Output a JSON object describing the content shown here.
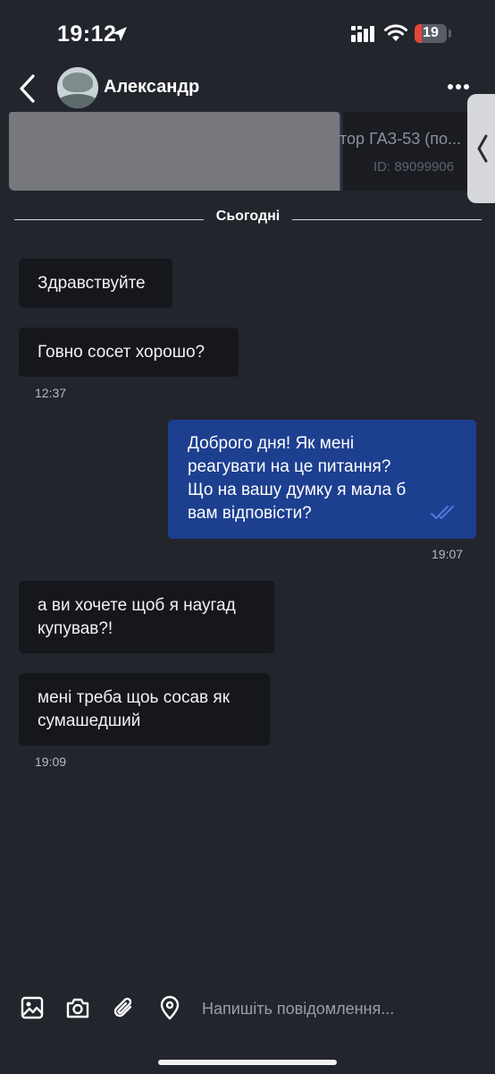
{
  "status_bar": {
    "time": "19:12",
    "battery": "19"
  },
  "header": {
    "contact_name": "Александр"
  },
  "listing": {
    "title": "тор ГАЗ-53 (по...",
    "id": "ID: 89099906"
  },
  "date_separator": "Сьогодні",
  "messages": [
    {
      "direction": "in",
      "text": "Здравствуйте"
    },
    {
      "direction": "in",
      "text": "Говно сосет хорошо?",
      "time": "12:37"
    },
    {
      "direction": "out",
      "lines": [
        "Доброго дня! Як мені",
        "реагувати на це питання?",
        "Що на вашу думку я мала б",
        "вам відповісти?"
      ],
      "time": "19:07",
      "status": "read"
    },
    {
      "direction": "in",
      "lines": [
        "а ви хочете щоб я наугад",
        "купував?!"
      ]
    },
    {
      "direction": "in",
      "lines": [
        "мені треба щоь сосав як",
        "сумашедший"
      ],
      "time": "19:09"
    }
  ],
  "composer": {
    "placeholder": "Напишіть повідомлення..."
  },
  "icons": {
    "back": "chevron-left-icon",
    "more": "more-dots-icon",
    "side_tab": "chevron-left-icon",
    "gallery": "image-icon",
    "camera": "camera-icon",
    "attach": "paperclip-icon",
    "location": "location-pin-icon"
  },
  "colors": {
    "background": "#23252d",
    "incoming_bubble": "#15171c",
    "outgoing_bubble": "#1d3f90",
    "read_ticks": "#4d79d8",
    "battery_low": "#e5463b"
  }
}
